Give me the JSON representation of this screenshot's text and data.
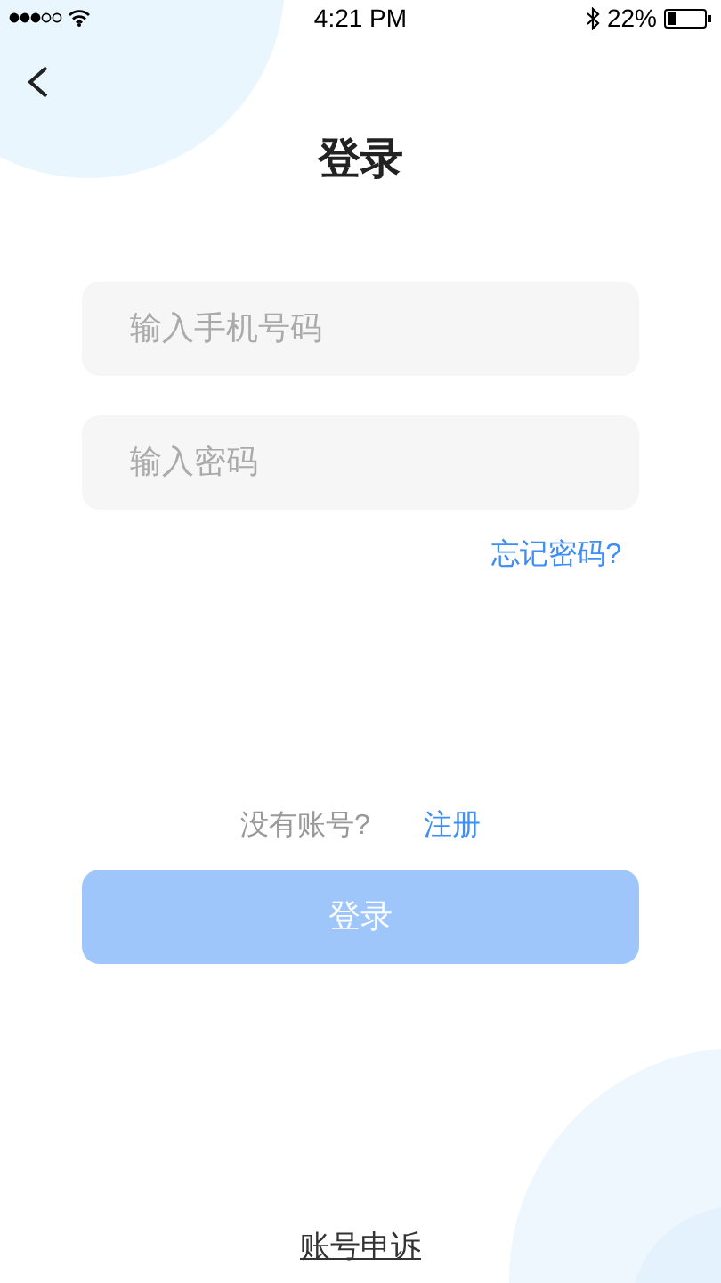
{
  "status_bar": {
    "time": "4:21 PM",
    "battery": "22%"
  },
  "title": "登录",
  "fields": [
    {
      "placeholder": "输入手机号码"
    },
    {
      "placeholder": "输入密码"
    }
  ],
  "forgot_link": "忘记密码?",
  "signup_prompt": {
    "text": "没有账号?",
    "link": "注册"
  },
  "login_button": {
    "label": "登录",
    "disabled": true
  },
  "appeal_link": "账号申诉"
}
